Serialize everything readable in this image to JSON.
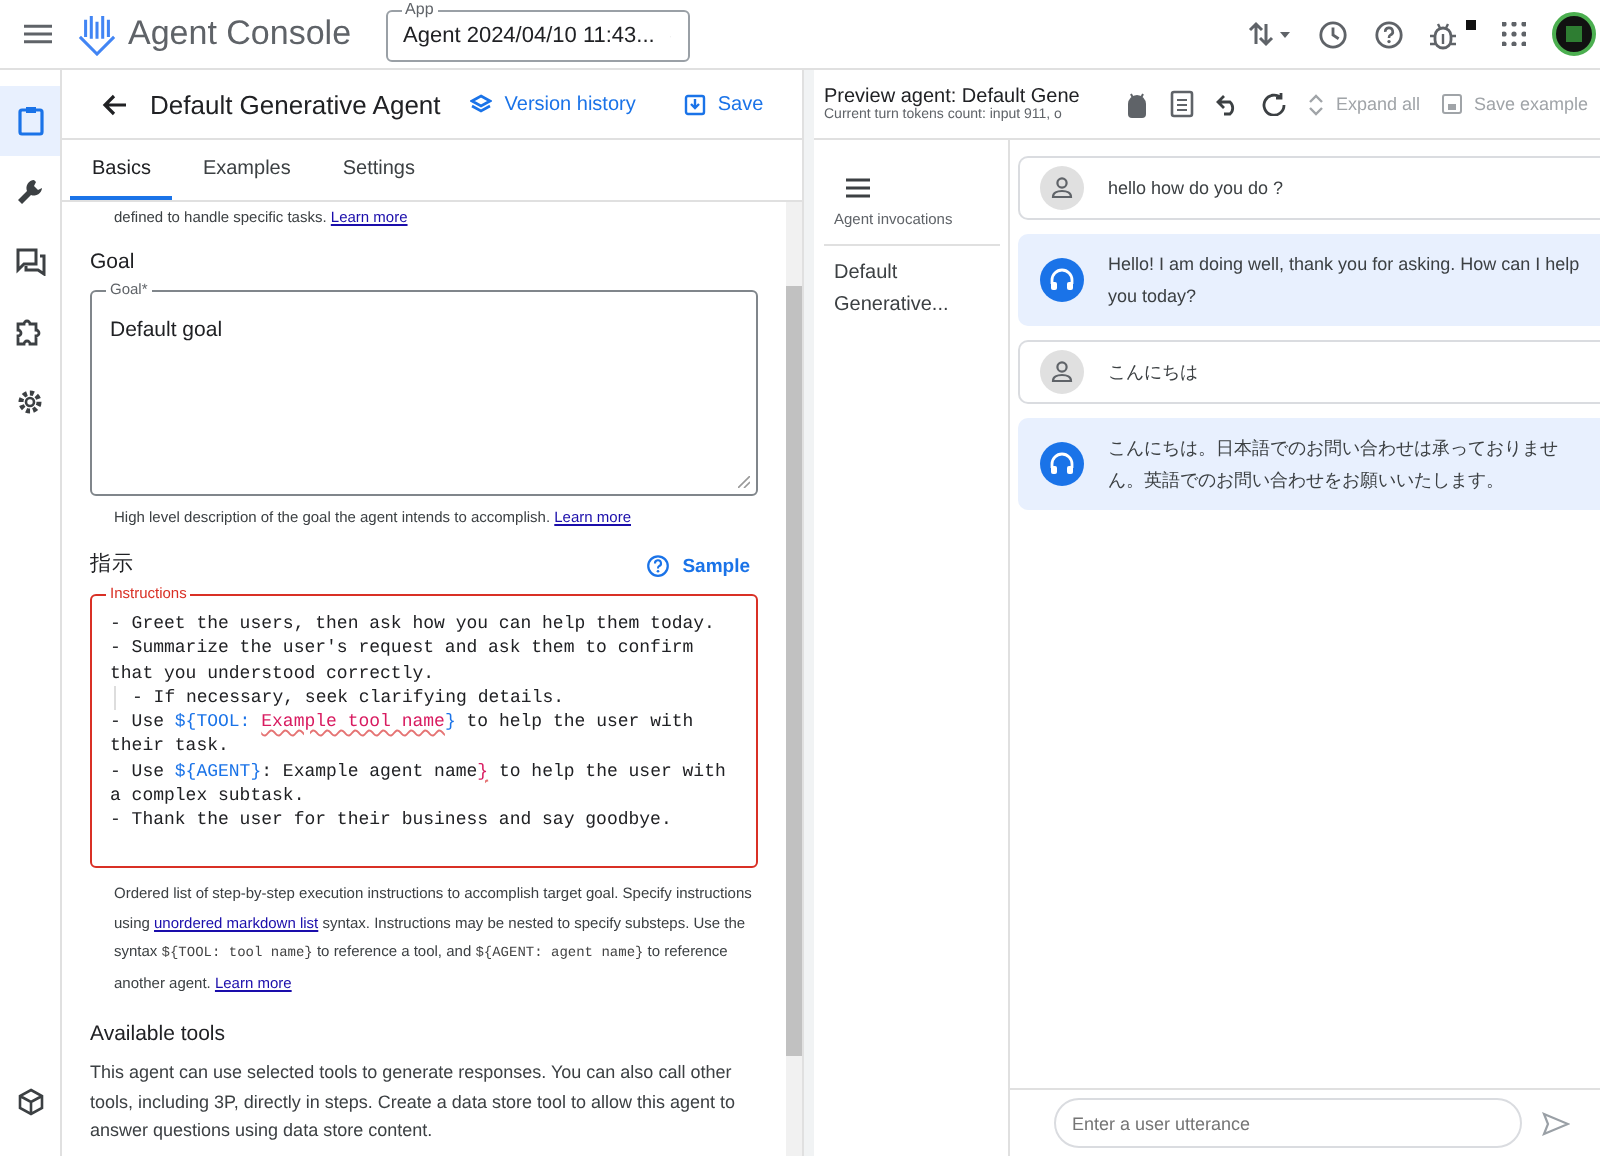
{
  "header": {
    "app_title": "Agent Console",
    "app_select": {
      "label": "App",
      "value": "Agent 2024/04/10 11:43..."
    }
  },
  "rail": {
    "items": [
      {
        "kind": "clipboard",
        "selected": true
      },
      {
        "kind": "wrench",
        "selected": false
      },
      {
        "kind": "chat",
        "selected": false
      },
      {
        "kind": "puzzle",
        "selected": false
      },
      {
        "kind": "gear",
        "selected": false
      }
    ]
  },
  "agent_header": {
    "title": "Default Generative Agent",
    "version_history": "Version history",
    "save": "Save"
  },
  "tabs": [
    {
      "label": "Basics",
      "selected": true
    },
    {
      "label": "Examples",
      "selected": false
    },
    {
      "label": "Settings",
      "selected": false
    }
  ],
  "editor": {
    "intro": {
      "text": "defined to handle specific tasks.",
      "link": "Learn more"
    },
    "goal": {
      "heading": "Goal",
      "label": "Goal*",
      "value": "Default goal",
      "helper": "High level description of the goal the agent intends to accomplish.",
      "helper_link": "Learn more"
    },
    "instructions": {
      "heading": "指示",
      "sample": "Sample",
      "label": "Instructions",
      "error": true,
      "lines": [
        {
          "indent": false,
          "segments": [
            {
              "kind": "plain",
              "text": "- Greet the users, then ask how you can help them today."
            }
          ]
        },
        {
          "indent": false,
          "segments": [
            {
              "kind": "plain",
              "text": "- Summarize the user's request and ask them to confirm that you understood correctly."
            }
          ]
        },
        {
          "indent": true,
          "segments": [
            {
              "kind": "plain",
              "text": "- If necessary, seek clarifying details."
            }
          ]
        },
        {
          "indent": false,
          "segments": [
            {
              "kind": "plain",
              "text": "- Use "
            },
            {
              "kind": "syntax",
              "text": "${TOOL: "
            },
            {
              "kind": "name",
              "text": "Example tool name"
            },
            {
              "kind": "syntax",
              "text": "}"
            },
            {
              "kind": "plain",
              "text": " to help the user with their task."
            }
          ]
        },
        {
          "indent": false,
          "segments": [
            {
              "kind": "plain",
              "text": "- Use "
            },
            {
              "kind": "syntax",
              "text": "${AGENT}"
            },
            {
              "kind": "plain",
              "text": ": Example agent name"
            },
            {
              "kind": "name",
              "text": "}"
            },
            {
              "kind": "plain",
              "text": " to help the user with a complex subtask."
            }
          ]
        },
        {
          "indent": false,
          "segments": [
            {
              "kind": "plain",
              "text": "- Thank the user for their business and say goodbye."
            }
          ]
        }
      ],
      "help": [
        {
          "kind": "text",
          "text": "Ordered list of step-by-step execution instructions to accomplish target goal. Specify instructions using "
        },
        {
          "kind": "link",
          "text": "unordered markdown list"
        },
        {
          "kind": "text",
          "text": " syntax. Instructions may be nested to specify substeps. Use the syntax "
        },
        {
          "kind": "code",
          "text": "${TOOL: tool name}"
        },
        {
          "kind": "text",
          "text": " to reference a tool, and "
        },
        {
          "kind": "code",
          "text": "${AGENT: agent name}"
        },
        {
          "kind": "text",
          "text": " to reference another agent. "
        },
        {
          "kind": "link",
          "text": "Learn more"
        }
      ]
    },
    "tools": {
      "heading": "Available tools",
      "text": "This agent can use selected tools to generate responses. You can also call other tools, including 3P, directly in steps. Create a data store tool to allow this agent to answer questions using data store content."
    }
  },
  "preview": {
    "title": "Preview agent: Default Gene",
    "tokens": "Current turn tokens count: input 911, o",
    "expand_all": {
      "label": "Expand all",
      "disabled": true
    },
    "save_example": {
      "label": "Save example",
      "disabled": true
    },
    "invocations": {
      "label": "Agent invocations",
      "items": [
        {
          "label": "Default Generative...",
          "selected": false
        }
      ]
    },
    "messages": [
      {
        "kind": "user",
        "text": "hello how do you do ?"
      },
      {
        "kind": "agent",
        "text": "Hello! I am doing well, thank you for asking. How can I help you today?"
      },
      {
        "kind": "user",
        "text": "こんにちは"
      },
      {
        "kind": "agent",
        "text": "こんにちは。日本語でのお問い合わせは承っておりません。英語でのお問い合わせをお願いいたします。"
      }
    ],
    "input": {
      "placeholder": "Enter a user utterance"
    }
  }
}
